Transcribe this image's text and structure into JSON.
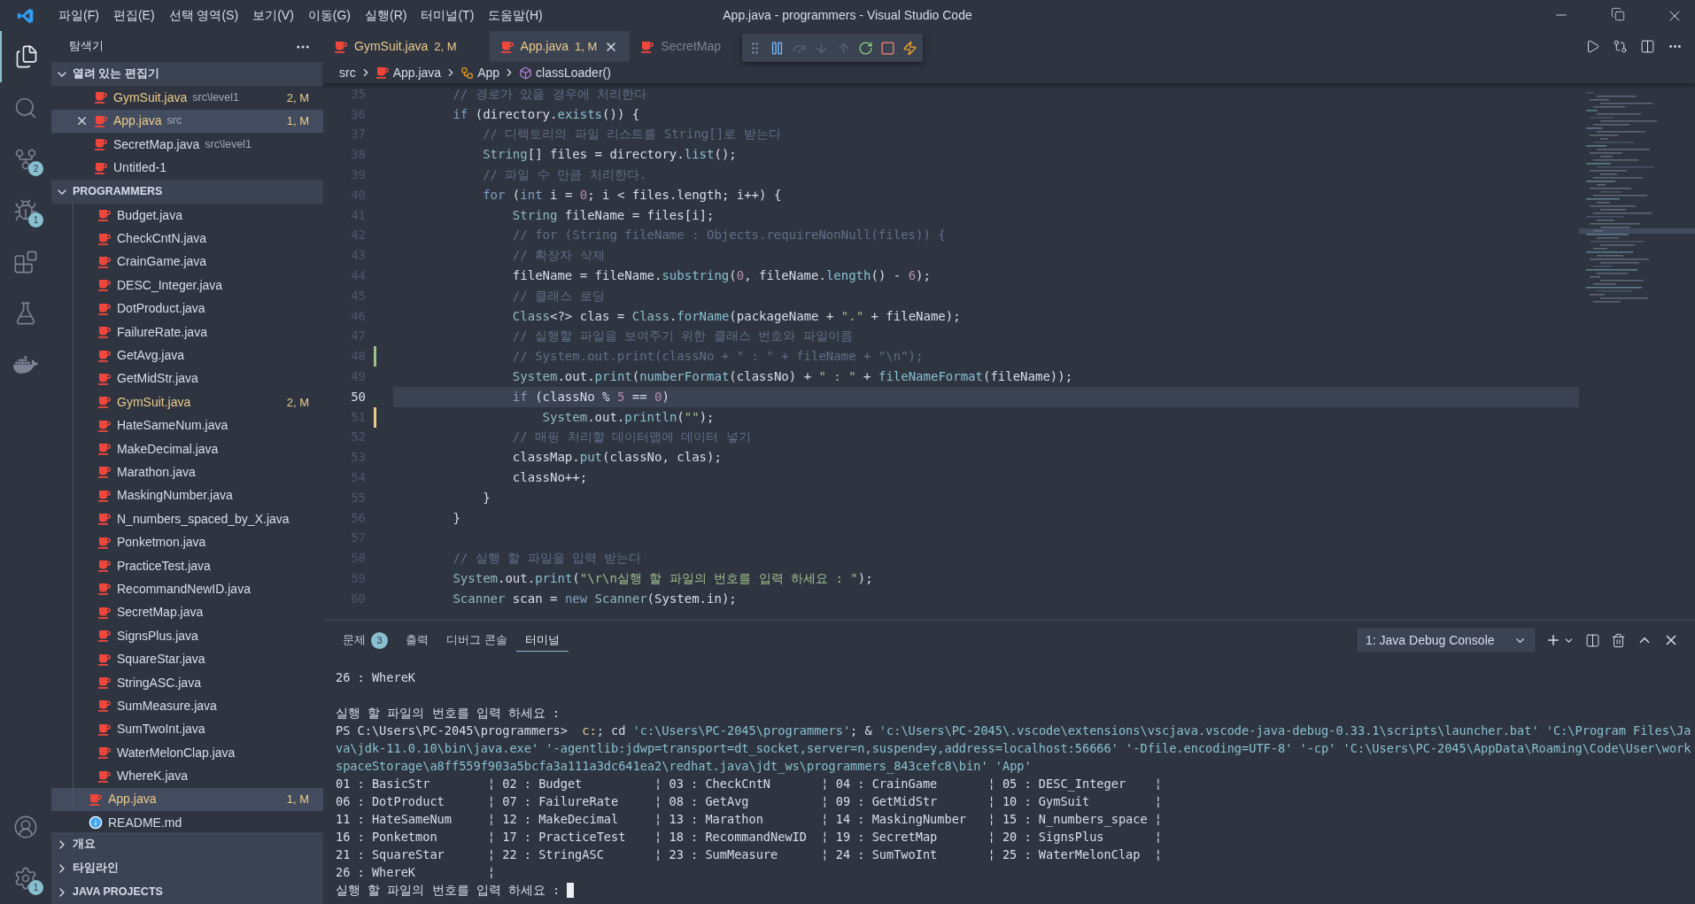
{
  "title_bar": {
    "menu": [
      "파일(F)",
      "편집(E)",
      "선택 영역(S)",
      "보기(V)",
      "이동(G)",
      "실행(R)",
      "터미널(T)",
      "도움말(H)"
    ],
    "title": "App.java - programmers - Visual Studio Code"
  },
  "activity_bar": {
    "top": [
      {
        "kind": "files",
        "selected": true
      },
      {
        "kind": "search",
        "selected": false
      },
      {
        "kind": "source-control",
        "selected": false,
        "badge": "2"
      },
      {
        "kind": "debug",
        "selected": false,
        "badge": "1"
      },
      {
        "kind": "extensions",
        "selected": false
      },
      {
        "kind": "testing",
        "selected": false
      },
      {
        "kind": "docker",
        "selected": false
      }
    ],
    "bottom": [
      {
        "kind": "account"
      },
      {
        "kind": "settings",
        "badge": "1"
      }
    ]
  },
  "sidebar": {
    "title": "탐색기",
    "open_editors": {
      "title": "열려 있는 편집기",
      "expanded": true,
      "items": [
        {
          "name": "GymSuit.java",
          "path": "src\\level1",
          "badge": "2, M",
          "modified": true,
          "selected": false
        },
        {
          "name": "App.java",
          "path": "src",
          "badge": "1, M",
          "modified": true,
          "selected": true
        },
        {
          "name": "SecretMap.java",
          "path": "src\\level1",
          "modified": false,
          "selected": false
        },
        {
          "name": "Untitled-1",
          "modified": false,
          "selected": false
        }
      ]
    },
    "project": {
      "title": "PROGRAMMERS",
      "expanded": true,
      "children": [
        {
          "children": [
            {
              "children": [
                {
                  "name": "Budget.java",
                  "modified": false,
                  "selected": false
                },
                {
                  "name": "CheckCntN.java",
                  "modified": false,
                  "selected": false
                },
                {
                  "name": "CrainGame.java",
                  "modified": false,
                  "selected": false
                },
                {
                  "name": "DESC_Integer.java",
                  "modified": false,
                  "selected": false
                },
                {
                  "name": "DotProduct.java",
                  "modified": false,
                  "selected": false
                },
                {
                  "name": "FailureRate.java",
                  "modified": false,
                  "selected": false
                },
                {
                  "name": "GetAvg.java",
                  "modified": false,
                  "selected": false
                },
                {
                  "name": "GetMidStr.java",
                  "modified": false,
                  "selected": false
                },
                {
                  "name": "GymSuit.java",
                  "badge": "2, M",
                  "modified": true,
                  "selected": false
                },
                {
                  "name": "HateSameNum.java",
                  "modified": false,
                  "selected": false
                },
                {
                  "name": "MakeDecimal.java",
                  "modified": false,
                  "selected": false
                },
                {
                  "name": "Marathon.java",
                  "modified": false,
                  "selected": false
                },
                {
                  "name": "MaskingNumber.java",
                  "modified": false,
                  "selected": false
                },
                {
                  "name": "N_numbers_spaced_by_X.java",
                  "modified": false,
                  "selected": false
                },
                {
                  "name": "Ponketmon.java",
                  "modified": false,
                  "selected": false
                },
                {
                  "name": "PracticeTest.java",
                  "modified": false,
                  "selected": false
                },
                {
                  "name": "RecommandNewID.java",
                  "modified": false,
                  "selected": false
                },
                {
                  "name": "SecretMap.java",
                  "modified": false,
                  "selected": false
                },
                {
                  "name": "SignsPlus.java",
                  "modified": false,
                  "selected": false
                },
                {
                  "name": "SquareStar.java",
                  "modified": false,
                  "selected": false
                },
                {
                  "name": "StringASC.java",
                  "modified": false,
                  "selected": false
                },
                {
                  "name": "SumMeasure.java",
                  "modified": false,
                  "selected": false
                },
                {
                  "name": "SumTwoInt.java",
                  "modified": false,
                  "selected": false
                },
                {
                  "name": "WaterMelonClap.java",
                  "modified": false,
                  "selected": false
                },
                {
                  "name": "WhereK.java",
                  "modified": false,
                  "selected": false
                }
              ]
            },
            {
              "name": "App.java",
              "badge": "1, M",
              "modified": true,
              "selected": true
            }
          ]
        },
        {
          "name": "README.md",
          "kind": "markdown",
          "modified": false,
          "selected": false
        }
      ]
    },
    "sections": [
      {
        "title": "개요",
        "expanded": false
      },
      {
        "title": "타임라인",
        "expanded": false
      },
      {
        "title": "JAVA PROJECTS",
        "expanded": false
      }
    ]
  },
  "editor": {
    "tabs": [
      {
        "name": "GymSuit.java",
        "badge": "2, M",
        "modified": true,
        "selected": false
      },
      {
        "name": "App.java",
        "badge": "1, M",
        "modified": true,
        "selected": true
      },
      {
        "name": "SecretMap",
        "modified": false,
        "selected": false
      }
    ],
    "debug_toolbar": [
      {
        "kind": "grip",
        "disabled": false
      },
      {
        "kind": "pause",
        "disabled": false
      },
      {
        "kind": "step-over",
        "disabled": true
      },
      {
        "kind": "step-into",
        "disabled": true
      },
      {
        "kind": "step-out",
        "disabled": true
      },
      {
        "kind": "restart",
        "disabled": false
      },
      {
        "kind": "stop",
        "disabled": false
      },
      {
        "kind": "hot-reload",
        "disabled": false
      }
    ],
    "breadcrumb": [
      {
        "kind": "folder",
        "text": "src"
      },
      {
        "kind": "file",
        "text": "App.java"
      },
      {
        "kind": "class",
        "text": "App"
      },
      {
        "kind": "method",
        "text": "classLoader()"
      }
    ],
    "lines": [
      {
        "number": "35",
        "current": false,
        "tokens": [
          {
            "text": "        // 경로가 있을 경우에 처리한다",
            "kind": "comment"
          }
        ]
      },
      {
        "number": "36",
        "current": false,
        "tokens": [
          {
            "text": "        if",
            "kind": "keyword"
          },
          {
            "text": " (directory.",
            "kind": "plain"
          },
          {
            "text": "exists",
            "kind": "function"
          },
          {
            "text": "()) {",
            "kind": "plain"
          }
        ]
      },
      {
        "number": "37",
        "current": false,
        "tokens": [
          {
            "text": "            // 디렉토리의 파일 리스트를 String[]로 받는다",
            "kind": "comment"
          }
        ]
      },
      {
        "number": "38",
        "current": false,
        "tokens": [
          {
            "text": "            String",
            "kind": "type"
          },
          {
            "text": "[] files = directory.",
            "kind": "plain"
          },
          {
            "text": "list",
            "kind": "function"
          },
          {
            "text": "();",
            "kind": "plain"
          }
        ]
      },
      {
        "number": "39",
        "current": false,
        "tokens": [
          {
            "text": "            // 파일 수 만큼 처리한다.",
            "kind": "comment"
          }
        ]
      },
      {
        "number": "40",
        "current": false,
        "tokens": [
          {
            "text": "            for",
            "kind": "keyword"
          },
          {
            "text": " (",
            "kind": "plain"
          },
          {
            "text": "int",
            "kind": "keyword"
          },
          {
            "text": " i = ",
            "kind": "plain"
          },
          {
            "text": "0",
            "kind": "number"
          },
          {
            "text": "; i < files.length; i++) {",
            "kind": "plain"
          }
        ]
      },
      {
        "number": "41",
        "current": false,
        "tokens": [
          {
            "text": "                String",
            "kind": "type"
          },
          {
            "text": " fileName = files[i];",
            "kind": "plain"
          }
        ]
      },
      {
        "number": "42",
        "current": false,
        "tokens": [
          {
            "text": "                // for (String fileName : Objects.requireNonNull(files)) {",
            "kind": "comment"
          }
        ]
      },
      {
        "number": "43",
        "current": false,
        "tokens": [
          {
            "text": "                // 확장자 삭제",
            "kind": "comment"
          }
        ]
      },
      {
        "number": "44",
        "current": false,
        "tokens": [
          {
            "text": "                fileName = fileName.",
            "kind": "plain"
          },
          {
            "text": "substring",
            "kind": "function"
          },
          {
            "text": "(",
            "kind": "plain"
          },
          {
            "text": "0",
            "kind": "number"
          },
          {
            "text": ", fileName.",
            "kind": "plain"
          },
          {
            "text": "length",
            "kind": "function"
          },
          {
            "text": "() - ",
            "kind": "plain"
          },
          {
            "text": "6",
            "kind": "number"
          },
          {
            "text": ");",
            "kind": "plain"
          }
        ]
      },
      {
        "number": "45",
        "current": false,
        "tokens": [
          {
            "text": "                // 클래스 로딩",
            "kind": "comment"
          }
        ]
      },
      {
        "number": "46",
        "current": false,
        "tokens": [
          {
            "text": "                Class",
            "kind": "type"
          },
          {
            "text": "<?> clas = ",
            "kind": "plain"
          },
          {
            "text": "Class",
            "kind": "type"
          },
          {
            "text": ".",
            "kind": "plain"
          },
          {
            "text": "forName",
            "kind": "function"
          },
          {
            "text": "(packageName + ",
            "kind": "plain"
          },
          {
            "text": "\".\"",
            "kind": "string"
          },
          {
            "text": " + fileName);",
            "kind": "plain"
          }
        ]
      },
      {
        "number": "47",
        "current": false,
        "tokens": [
          {
            "text": "                // 실행할 파일을 보여주기 위한 클래스 번호와 파일이름",
            "kind": "comment"
          }
        ]
      },
      {
        "number": "48",
        "current": false,
        "kind": "added",
        "tokens": [
          {
            "text": "                // System.out.print(classNo + \" : \" + fileName + \"\\n\");",
            "kind": "comment"
          }
        ]
      },
      {
        "number": "49",
        "current": false,
        "tokens": [
          {
            "text": "                System",
            "kind": "type"
          },
          {
            "text": ".out.",
            "kind": "plain"
          },
          {
            "text": "print",
            "kind": "function"
          },
          {
            "text": "(",
            "kind": "plain"
          },
          {
            "text": "numberFormat",
            "kind": "function"
          },
          {
            "text": "(classNo) + ",
            "kind": "plain"
          },
          {
            "text": "\" : \"",
            "kind": "string"
          },
          {
            "text": " + ",
            "kind": "plain"
          },
          {
            "text": "fileNameFormat",
            "kind": "function"
          },
          {
            "text": "(fileName));",
            "kind": "plain"
          }
        ]
      },
      {
        "number": "50",
        "current": true,
        "tokens": [
          {
            "text": "                if",
            "kind": "keyword"
          },
          {
            "text": " (classNo % ",
            "kind": "plain"
          },
          {
            "text": "5",
            "kind": "number"
          },
          {
            "text": " == ",
            "kind": "plain"
          },
          {
            "text": "0",
            "kind": "number"
          },
          {
            "text": ")",
            "kind": "plain"
          }
        ]
      },
      {
        "number": "51",
        "current": false,
        "kind": "modified",
        "tokens": [
          {
            "text": "                    System",
            "kind": "type"
          },
          {
            "text": ".out.",
            "kind": "plain"
          },
          {
            "text": "println",
            "kind": "function"
          },
          {
            "text": "(",
            "kind": "plain"
          },
          {
            "text": "\"\"",
            "kind": "string"
          },
          {
            "text": ");",
            "kind": "plain"
          }
        ]
      },
      {
        "number": "52",
        "current": false,
        "tokens": [
          {
            "text": "                // 매핑 처리할 데이터맵에 데이터 넣기",
            "kind": "comment"
          }
        ]
      },
      {
        "number": "53",
        "current": false,
        "tokens": [
          {
            "text": "                classMap.",
            "kind": "plain"
          },
          {
            "text": "put",
            "kind": "function"
          },
          {
            "text": "(classNo, clas);",
            "kind": "plain"
          }
        ]
      },
      {
        "number": "54",
        "current": false,
        "tokens": [
          {
            "text": "                classNo++;",
            "kind": "plain"
          }
        ]
      },
      {
        "number": "55",
        "current": false,
        "tokens": [
          {
            "text": "            }",
            "kind": "plain"
          }
        ]
      },
      {
        "number": "56",
        "current": false,
        "tokens": [
          {
            "text": "        }",
            "kind": "plain"
          }
        ]
      },
      {
        "number": "57",
        "current": false
      },
      {
        "number": "58",
        "current": false,
        "tokens": [
          {
            "text": "        // 실행 할 파일을 입력 받는다",
            "kind": "comment"
          }
        ]
      },
      {
        "number": "59",
        "current": false,
        "tokens": [
          {
            "text": "        System",
            "kind": "type"
          },
          {
            "text": ".out.",
            "kind": "plain"
          },
          {
            "text": "print",
            "kind": "function"
          },
          {
            "text": "(",
            "kind": "plain"
          },
          {
            "text": "\"\\r\\n실행 할 파일의 번호를 입력 하세요 : \"",
            "kind": "string"
          },
          {
            "text": ");",
            "kind": "plain"
          }
        ]
      },
      {
        "number": "60",
        "current": false,
        "tokens": [
          {
            "text": "        Scanner",
            "kind": "type"
          },
          {
            "text": " scan = ",
            "kind": "plain"
          },
          {
            "text": "new",
            "kind": "keyword"
          },
          {
            "text": " Scanner",
            "kind": "type"
          },
          {
            "text": "(System.in);",
            "kind": "plain"
          }
        ]
      }
    ]
  },
  "panel": {
    "tabs": [
      {
        "label": "문제",
        "badge": "3",
        "selected": false
      },
      {
        "label": "출력",
        "selected": false
      },
      {
        "label": "디버그 콘솔",
        "selected": false
      },
      {
        "label": "터미널",
        "selected": true
      }
    ],
    "terminal_select": "1: Java Debug Console",
    "lines": [
      {
        "kind": "text",
        "text": "26 : WhereK"
      },
      {
        "kind": "blank"
      },
      {
        "kind": "text",
        "text": "실행 할 파일의 번호를 입력 하세요 :"
      },
      {
        "kind": "command",
        "segments": [
          {
            "text": "PS C:\\Users\\PC-2045\\programmers> ",
            "kind": "plain"
          },
          {
            "text": " c:",
            "kind": "command"
          },
          {
            "text": "; cd ",
            "kind": "plain"
          },
          {
            "text": "'c:\\Users\\PC-2045\\programmers'",
            "kind": "string"
          },
          {
            "text": "; & ",
            "kind": "plain"
          },
          {
            "text": "'c:\\Users\\PC-2045\\.vscode\\extensions\\vscjava.vscode-java-debug-0.33.1\\scripts\\launcher.bat'",
            "kind": "string"
          },
          {
            "text": " 'C:\\Program Files\\Java\\jdk-11.0.10\\bin\\java.exe'",
            "kind": "string"
          },
          {
            "text": " '-agentlib:jdwp=transport=dt_socket,server=n,suspend=y,address=localhost:56666'",
            "kind": "string"
          },
          {
            "text": " '-Dfile.encoding=UTF-8'",
            "kind": "string"
          },
          {
            "text": " '-cp'",
            "kind": "string"
          },
          {
            "text": " 'C:\\Users\\PC-2045\\AppData\\Roaming\\Code\\User\\workspaceStorage\\a8ff559f903a5bcfa3a111a3dc641ea2\\redhat.java\\jdt_ws\\programmers_843cefc8\\bin'",
            "kind": "string"
          },
          {
            "text": " 'App'",
            "kind": "string"
          }
        ]
      },
      {
        "kind": "text",
        "text": "01 : BasicStr        ¦ 02 : Budget          ¦ 03 : CheckCntN       ¦ 04 : CrainGame       ¦ 05 : DESC_Integer    ¦"
      },
      {
        "kind": "text",
        "text": "06 : DotProduct      ¦ 07 : FailureRate     ¦ 08 : GetAvg          ¦ 09 : GetMidStr       ¦ 10 : GymSuit         ¦"
      },
      {
        "kind": "text",
        "text": "11 : HateSameNum     ¦ 12 : MakeDecimal     ¦ 13 : Marathon        ¦ 14 : MaskingNumber   ¦ 15 : N_numbers_space ¦"
      },
      {
        "kind": "text",
        "text": "16 : Ponketmon       ¦ 17 : PracticeTest    ¦ 18 : RecommandNewID  ¦ 19 : SecretMap       ¦ 20 : SignsPlus       ¦"
      },
      {
        "kind": "text",
        "text": "21 : SquareStar      ¦ 22 : StringASC       ¦ 23 : SumMeasure      ¦ 24 : SumTwoInt       ¦ 25 : WaterMelonClap  ¦"
      },
      {
        "kind": "text",
        "text": "26 : WhereK          ¦"
      },
      {
        "kind": "input",
        "text": "실행 할 파일의 번호를 입력 하세요 :"
      }
    ]
  }
}
